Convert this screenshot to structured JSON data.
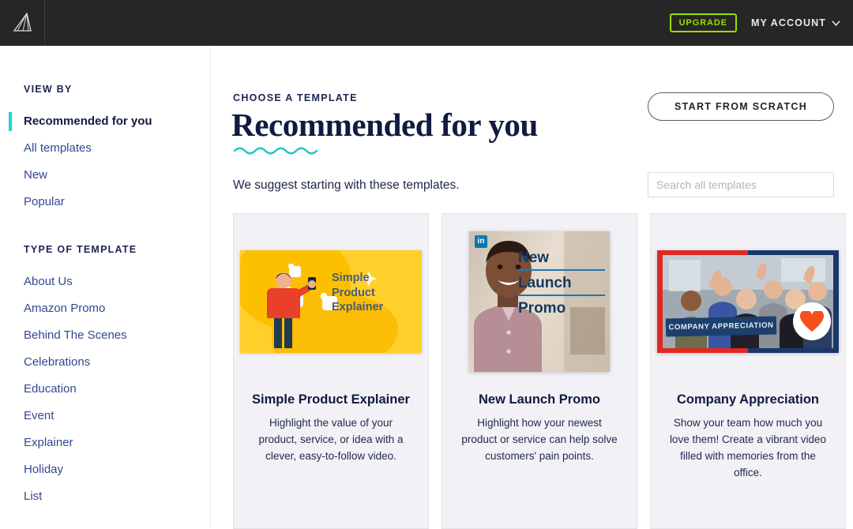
{
  "topbar": {
    "logo_icon": "wing-logo-icon",
    "upgrade_label": "UPGRADE",
    "account_label": "MY ACCOUNT",
    "chevron_icon": "chevron-down-icon",
    "upgrade_color": "#9ade00",
    "background": "#262626"
  },
  "sidebar": {
    "view_by_heading": "VIEW BY",
    "view_by_items": [
      {
        "label": "Recommended for you",
        "active": true
      },
      {
        "label": "All templates",
        "active": false
      },
      {
        "label": "New",
        "active": false
      },
      {
        "label": "Popular",
        "active": false
      }
    ],
    "type_heading": "TYPE OF TEMPLATE",
    "type_items": [
      {
        "label": "About Us"
      },
      {
        "label": "Amazon Promo"
      },
      {
        "label": "Behind The Scenes"
      },
      {
        "label": "Celebrations"
      },
      {
        "label": "Education"
      },
      {
        "label": "Event"
      },
      {
        "label": "Explainer"
      },
      {
        "label": "Holiday"
      },
      {
        "label": "List"
      }
    ],
    "active_accent": "#23d3cd",
    "link_color": "#34488f"
  },
  "main": {
    "eyebrow": "CHOOSE A TEMPLATE",
    "title": "Recommended for you",
    "subtitle": "We suggest starting with these templates.",
    "squiggle_color": "#23c4c4",
    "scratch_button": "START FROM SCRATCH",
    "search_placeholder": "Search all templates",
    "search_value": ""
  },
  "cards": [
    {
      "title": "Simple Product Explainer",
      "description": "Highlight the value of your product, service, or idea with a clever, easy-to-follow video.",
      "thumb_text_lines": [
        "Simple",
        "Product",
        "Explainer"
      ],
      "thumb_bg": "#ffd02a",
      "thumb_text_color": "#4a5a78"
    },
    {
      "title": "New Launch Promo",
      "description": "Highlight how your newest product or service can help solve customers' pain points.",
      "thumb_text_lines": [
        "New",
        "Launch",
        "Promo"
      ],
      "badge_icon": "linkedin-icon",
      "badge_label": "in",
      "thumb_text_color": "#123a63",
      "rule_color": "#1878b8"
    },
    {
      "title": "Company Appreciation",
      "description": "Show your team how much you love them! Create a vibrant video filled with memories from the office.",
      "banner_text": "COMPANY APPRECIATION",
      "frame_left_color": "#e02822",
      "frame_right_color": "#18386b",
      "heart_icon": "heart-icon",
      "heart_color": "#f4511e"
    }
  ]
}
